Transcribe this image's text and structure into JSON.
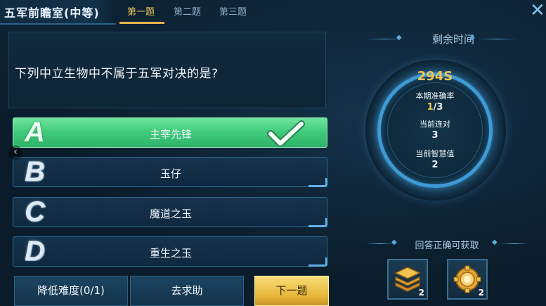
{
  "header": {
    "title": "五军前瞻室(中等)",
    "tabs": [
      {
        "label": "第一题",
        "active": true
      },
      {
        "label": "第二题",
        "active": false
      },
      {
        "label": "第三题",
        "active": false
      }
    ],
    "close_icon": "close-icon"
  },
  "question": {
    "text": "下列中立生物中不属于五军对决的是?"
  },
  "options": [
    {
      "letter": "A",
      "label": "主宰先锋",
      "selected_correct": true
    },
    {
      "letter": "B",
      "label": "玉仔"
    },
    {
      "letter": "C",
      "label": "魔道之玉"
    },
    {
      "letter": "D",
      "label": "重生之玉"
    }
  ],
  "bottom_buttons": {
    "lower_difficulty": "降低难度(0/1)",
    "seek_help": "去求助",
    "next": "下一题"
  },
  "timer": {
    "label": "剩余时间",
    "seconds": "294S",
    "accuracy_label": "本期准确率",
    "accuracy_correct": "1",
    "accuracy_total": "/3",
    "streak_label": "当前连对",
    "streak_value": "3",
    "wisdom_label": "当前智慧值",
    "wisdom_value": "2"
  },
  "rewards": {
    "label": "回答正确可获取",
    "items": [
      {
        "icon": "stacked-cards-icon",
        "count": "2"
      },
      {
        "icon": "gold-ring-coin-icon",
        "count": "2"
      }
    ]
  },
  "colors": {
    "correct_green": "#3fc97a",
    "accent_gold": "#f3c553",
    "ring_blue": "#3f9ad6"
  }
}
